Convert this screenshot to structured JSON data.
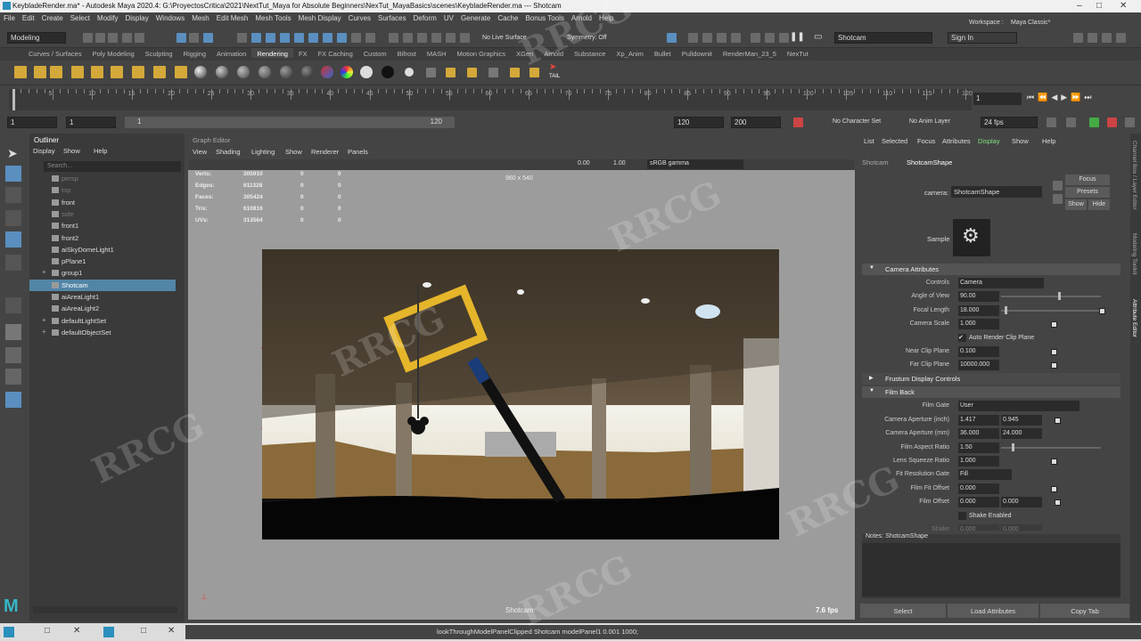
{
  "window": {
    "title": "KeybladeRender.ma* - Autodesk Maya 2020.4: G:\\ProyectosCritica\\2021\\NextTut_Maya for Absolute Beginners\\NexTut_MayaBasics\\scenes\\KeybladeRender.ma  ---  Shotcam"
  },
  "menu": [
    "File",
    "Edit",
    "Create",
    "Select",
    "Modify",
    "Display",
    "Windows",
    "Mesh",
    "Edit Mesh",
    "Mesh Tools",
    "Mesh Display",
    "Curves",
    "Surfaces",
    "Deform",
    "UV",
    "Generate",
    "Cache",
    "Bonus Tools",
    "Arnold",
    "Help"
  ],
  "status": {
    "mode": "Modeling",
    "live_surface": "No Live Surface",
    "symmetry": "Symmetry: Off",
    "camera_field": "Shotcam",
    "sign_in": "Sign In",
    "workspace_label": "Workspace :",
    "workspace": "Maya Classic*"
  },
  "shelf_tabs": [
    "Curves / Surfaces",
    "Poly Modeling",
    "Sculpting",
    "Rigging",
    "Animation",
    "Rendering",
    "FX",
    "FX Caching",
    "Custom",
    "Bifrost",
    "MASH",
    "Motion Graphics",
    "XGen",
    "Arnold",
    "Substance",
    "Xp_Anim",
    "Bullet",
    "Pulldownit",
    "RenderMan_23_5",
    "NexTut"
  ],
  "shelf_active": "Rendering",
  "shelf_icon_label": "TAIL",
  "timeline": {
    "ticks": [
      "5",
      "10",
      "15",
      "20",
      "25",
      "30",
      "35",
      "40",
      "45",
      "50",
      "55",
      "60",
      "65",
      "70",
      "75",
      "80",
      "85",
      "90",
      "95",
      "100",
      "105",
      "110",
      "115",
      "120"
    ],
    "current_frame": "1",
    "start": "1",
    "start2": "1",
    "range_start": "1",
    "range_end": "120",
    "end": "120",
    "end2": "200",
    "character_set": "No Character Set",
    "anim_layer": "No Anim Layer",
    "fps": "24 fps"
  },
  "outliner": {
    "title": "Outliner",
    "menu": [
      "Display",
      "Show",
      "Help"
    ],
    "search_placeholder": "Search...",
    "items": [
      {
        "label": "persp",
        "dim": true
      },
      {
        "label": "top",
        "dim": true
      },
      {
        "label": "front",
        "dim": false
      },
      {
        "label": "side",
        "dim": true
      },
      {
        "label": "front1",
        "dim": false
      },
      {
        "label": "front2",
        "dim": false
      },
      {
        "label": "aiSkyDomeLight1",
        "dim": false
      },
      {
        "label": "pPlane1",
        "dim": false
      },
      {
        "label": "group1",
        "dim": false
      },
      {
        "label": "Shotcam",
        "dim": false,
        "selected": true
      },
      {
        "label": "aiAreaLight1",
        "dim": false
      },
      {
        "label": "aiAreaLight2",
        "dim": false
      },
      {
        "label": "defaultLightSet",
        "dim": false
      },
      {
        "label": "defaultObjectSet",
        "dim": false
      }
    ]
  },
  "viewport": {
    "panel_title": "Graph Editor",
    "menu": [
      "View",
      "Shading",
      "Lighting",
      "Show",
      "Renderer",
      "Panels"
    ],
    "exposure": "0.00",
    "gamma": "1.00",
    "color_space": "sRGB gamma",
    "resolution": "960 x 540",
    "hud": [
      {
        "label": "Verts:",
        "a": "305910",
        "b": "0",
        "c": "0"
      },
      {
        "label": "Edges:",
        "a": "611328",
        "b": "0",
        "c": "0"
      },
      {
        "label": "Faces:",
        "a": "305424",
        "b": "0",
        "c": "0"
      },
      {
        "label": "Tris:",
        "a": "610816",
        "b": "0",
        "c": "0"
      },
      {
        "label": "UVs:",
        "a": "313564",
        "b": "0",
        "c": "0"
      }
    ],
    "fps": "7.6 fps",
    "camera_label": "Shotcam"
  },
  "attr": {
    "menu": [
      "List",
      "Selected",
      "Focus",
      "Attributes",
      "Display",
      "Show",
      "Help"
    ],
    "tabs": [
      "Shotcam",
      "ShotcamShape"
    ],
    "camera_label": "camera:",
    "camera_value": "ShotcamShape",
    "focus": "Focus",
    "presets": "Presets",
    "show": "Show",
    "hide": "Hide",
    "sample_label": "Sample",
    "sections": {
      "camera_attributes": "Camera Attributes",
      "frustum": "Frustum Display Controls",
      "film_back": "Film Back"
    },
    "rows": {
      "controls": {
        "label": "Controls",
        "value": "Camera"
      },
      "aov": {
        "label": "Angle of View",
        "value": "90.00"
      },
      "focal": {
        "label": "Focal Length",
        "value": "18.000"
      },
      "scale": {
        "label": "Camera Scale",
        "value": "1.000"
      },
      "auto_clip": "Auto Render Clip Plane",
      "near": {
        "label": "Near Clip Plane",
        "value": "0.100"
      },
      "far": {
        "label": "Far Clip Plane",
        "value": "10000.000"
      },
      "film_gate": {
        "label": "Film Gate",
        "value": "User"
      },
      "aperture_inch": {
        "label": "Camera Aperture (inch)",
        "a": "1.417",
        "b": "0.945"
      },
      "aperture_mm": {
        "label": "Camera Aperture (mm)",
        "a": "36.000",
        "b": "24.000"
      },
      "aspect": {
        "label": "Film Aspect Ratio",
        "value": "1.50"
      },
      "squeeze": {
        "label": "Lens Squeeze Ratio",
        "value": "1.000"
      },
      "fit_gate": {
        "label": "Fit Resolution Gate",
        "value": "Fill"
      },
      "fit_offset": {
        "label": "Film Fit Offset",
        "value": "0.000"
      },
      "film_offset": {
        "label": "Film Offset",
        "a": "0.000",
        "b": "0.000"
      },
      "shake_enabled": "Shake Enabled",
      "shake": {
        "label": "Shake",
        "a": "0.000",
        "b": "0.000"
      }
    },
    "notes": "Notes:  ShotcamShape",
    "buttons": [
      "Select",
      "Load Attributes",
      "Copy Tab"
    ]
  },
  "side_tabs": [
    "Channel Box / Layer Editor",
    "Modeling Toolkit",
    "Attribute Editor"
  ],
  "cmdline": "lookThroughModelPanelClipped Shotcam modelPanel1 0.001 1000;",
  "watermark": "RRCG",
  "colors": {
    "selection": "#5285a6",
    "maya_blue": "#2a8fbd"
  }
}
